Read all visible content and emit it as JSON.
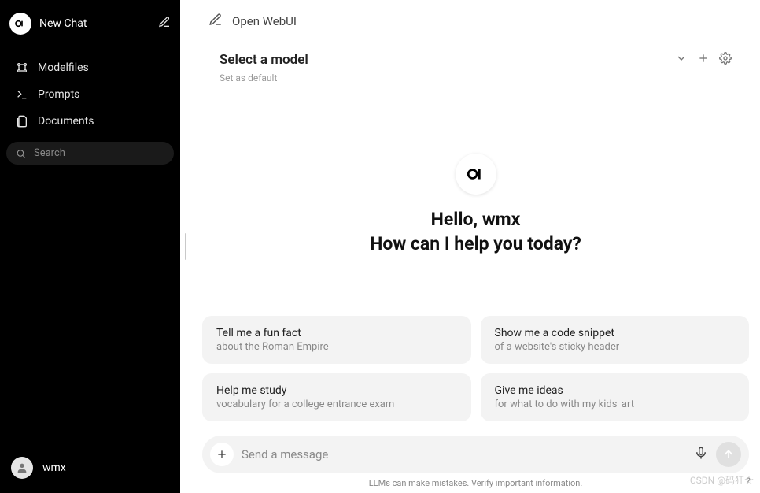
{
  "sidebar": {
    "new_chat_label": "New Chat",
    "nav": [
      {
        "label": "Modelfiles"
      },
      {
        "label": "Prompts"
      },
      {
        "label": "Documents"
      }
    ],
    "search_placeholder": "Search"
  },
  "user": {
    "name": "wmx"
  },
  "header": {
    "title": "Open WebUI"
  },
  "model": {
    "select_label": "Select a model",
    "set_default_label": "Set as default"
  },
  "center": {
    "greeting": "Hello, wmx",
    "subline": "How can I help you today?"
  },
  "suggestions": [
    {
      "title": "Tell me a fun fact",
      "sub": "about the Roman Empire"
    },
    {
      "title": "Show me a code snippet",
      "sub": "of a website's sticky header"
    },
    {
      "title": "Help me study",
      "sub": "vocabulary for a college entrance exam"
    },
    {
      "title": "Give me ideas",
      "sub": "for what to do with my kids' art"
    }
  ],
  "composer": {
    "placeholder": "Send a message"
  },
  "footer": {
    "disclaimer": "LLMs can make mistakes. Verify important information."
  },
  "watermark": "CSDN @码狂☆",
  "help_badge": "?"
}
